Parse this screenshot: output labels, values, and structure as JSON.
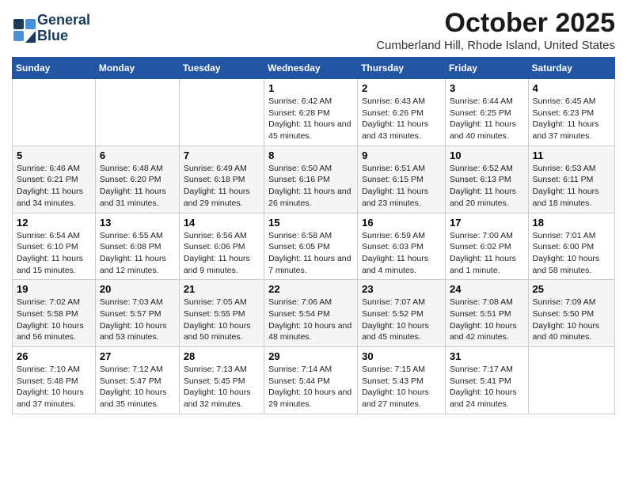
{
  "header": {
    "logo_line1": "General",
    "logo_line2": "Blue",
    "month": "October 2025",
    "location": "Cumberland Hill, Rhode Island, United States"
  },
  "weekdays": [
    "Sunday",
    "Monday",
    "Tuesday",
    "Wednesday",
    "Thursday",
    "Friday",
    "Saturday"
  ],
  "weeks": [
    [
      {
        "day": "",
        "sunrise": "",
        "sunset": "",
        "daylight": ""
      },
      {
        "day": "",
        "sunrise": "",
        "sunset": "",
        "daylight": ""
      },
      {
        "day": "",
        "sunrise": "",
        "sunset": "",
        "daylight": ""
      },
      {
        "day": "1",
        "sunrise": "Sunrise: 6:42 AM",
        "sunset": "Sunset: 6:28 PM",
        "daylight": "Daylight: 11 hours and 45 minutes."
      },
      {
        "day": "2",
        "sunrise": "Sunrise: 6:43 AM",
        "sunset": "Sunset: 6:26 PM",
        "daylight": "Daylight: 11 hours and 43 minutes."
      },
      {
        "day": "3",
        "sunrise": "Sunrise: 6:44 AM",
        "sunset": "Sunset: 6:25 PM",
        "daylight": "Daylight: 11 hours and 40 minutes."
      },
      {
        "day": "4",
        "sunrise": "Sunrise: 6:45 AM",
        "sunset": "Sunset: 6:23 PM",
        "daylight": "Daylight: 11 hours and 37 minutes."
      }
    ],
    [
      {
        "day": "5",
        "sunrise": "Sunrise: 6:46 AM",
        "sunset": "Sunset: 6:21 PM",
        "daylight": "Daylight: 11 hours and 34 minutes."
      },
      {
        "day": "6",
        "sunrise": "Sunrise: 6:48 AM",
        "sunset": "Sunset: 6:20 PM",
        "daylight": "Daylight: 11 hours and 31 minutes."
      },
      {
        "day": "7",
        "sunrise": "Sunrise: 6:49 AM",
        "sunset": "Sunset: 6:18 PM",
        "daylight": "Daylight: 11 hours and 29 minutes."
      },
      {
        "day": "8",
        "sunrise": "Sunrise: 6:50 AM",
        "sunset": "Sunset: 6:16 PM",
        "daylight": "Daylight: 11 hours and 26 minutes."
      },
      {
        "day": "9",
        "sunrise": "Sunrise: 6:51 AM",
        "sunset": "Sunset: 6:15 PM",
        "daylight": "Daylight: 11 hours and 23 minutes."
      },
      {
        "day": "10",
        "sunrise": "Sunrise: 6:52 AM",
        "sunset": "Sunset: 6:13 PM",
        "daylight": "Daylight: 11 hours and 20 minutes."
      },
      {
        "day": "11",
        "sunrise": "Sunrise: 6:53 AM",
        "sunset": "Sunset: 6:11 PM",
        "daylight": "Daylight: 11 hours and 18 minutes."
      }
    ],
    [
      {
        "day": "12",
        "sunrise": "Sunrise: 6:54 AM",
        "sunset": "Sunset: 6:10 PM",
        "daylight": "Daylight: 11 hours and 15 minutes."
      },
      {
        "day": "13",
        "sunrise": "Sunrise: 6:55 AM",
        "sunset": "Sunset: 6:08 PM",
        "daylight": "Daylight: 11 hours and 12 minutes."
      },
      {
        "day": "14",
        "sunrise": "Sunrise: 6:56 AM",
        "sunset": "Sunset: 6:06 PM",
        "daylight": "Daylight: 11 hours and 9 minutes."
      },
      {
        "day": "15",
        "sunrise": "Sunrise: 6:58 AM",
        "sunset": "Sunset: 6:05 PM",
        "daylight": "Daylight: 11 hours and 7 minutes."
      },
      {
        "day": "16",
        "sunrise": "Sunrise: 6:59 AM",
        "sunset": "Sunset: 6:03 PM",
        "daylight": "Daylight: 11 hours and 4 minutes."
      },
      {
        "day": "17",
        "sunrise": "Sunrise: 7:00 AM",
        "sunset": "Sunset: 6:02 PM",
        "daylight": "Daylight: 11 hours and 1 minute."
      },
      {
        "day": "18",
        "sunrise": "Sunrise: 7:01 AM",
        "sunset": "Sunset: 6:00 PM",
        "daylight": "Daylight: 10 hours and 58 minutes."
      }
    ],
    [
      {
        "day": "19",
        "sunrise": "Sunrise: 7:02 AM",
        "sunset": "Sunset: 5:58 PM",
        "daylight": "Daylight: 10 hours and 56 minutes."
      },
      {
        "day": "20",
        "sunrise": "Sunrise: 7:03 AM",
        "sunset": "Sunset: 5:57 PM",
        "daylight": "Daylight: 10 hours and 53 minutes."
      },
      {
        "day": "21",
        "sunrise": "Sunrise: 7:05 AM",
        "sunset": "Sunset: 5:55 PM",
        "daylight": "Daylight: 10 hours and 50 minutes."
      },
      {
        "day": "22",
        "sunrise": "Sunrise: 7:06 AM",
        "sunset": "Sunset: 5:54 PM",
        "daylight": "Daylight: 10 hours and 48 minutes."
      },
      {
        "day": "23",
        "sunrise": "Sunrise: 7:07 AM",
        "sunset": "Sunset: 5:52 PM",
        "daylight": "Daylight: 10 hours and 45 minutes."
      },
      {
        "day": "24",
        "sunrise": "Sunrise: 7:08 AM",
        "sunset": "Sunset: 5:51 PM",
        "daylight": "Daylight: 10 hours and 42 minutes."
      },
      {
        "day": "25",
        "sunrise": "Sunrise: 7:09 AM",
        "sunset": "Sunset: 5:50 PM",
        "daylight": "Daylight: 10 hours and 40 minutes."
      }
    ],
    [
      {
        "day": "26",
        "sunrise": "Sunrise: 7:10 AM",
        "sunset": "Sunset: 5:48 PM",
        "daylight": "Daylight: 10 hours and 37 minutes."
      },
      {
        "day": "27",
        "sunrise": "Sunrise: 7:12 AM",
        "sunset": "Sunset: 5:47 PM",
        "daylight": "Daylight: 10 hours and 35 minutes."
      },
      {
        "day": "28",
        "sunrise": "Sunrise: 7:13 AM",
        "sunset": "Sunset: 5:45 PM",
        "daylight": "Daylight: 10 hours and 32 minutes."
      },
      {
        "day": "29",
        "sunrise": "Sunrise: 7:14 AM",
        "sunset": "Sunset: 5:44 PM",
        "daylight": "Daylight: 10 hours and 29 minutes."
      },
      {
        "day": "30",
        "sunrise": "Sunrise: 7:15 AM",
        "sunset": "Sunset: 5:43 PM",
        "daylight": "Daylight: 10 hours and 27 minutes."
      },
      {
        "day": "31",
        "sunrise": "Sunrise: 7:17 AM",
        "sunset": "Sunset: 5:41 PM",
        "daylight": "Daylight: 10 hours and 24 minutes."
      },
      {
        "day": "",
        "sunrise": "",
        "sunset": "",
        "daylight": ""
      }
    ]
  ]
}
